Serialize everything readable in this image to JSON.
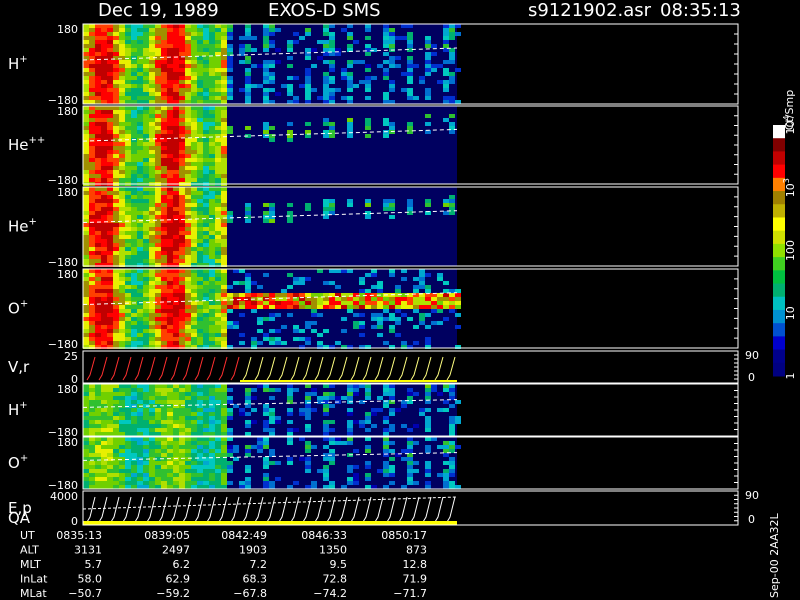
{
  "header": {
    "date": "Dec 19, 1989",
    "instrument": "EXOS-D SMS",
    "file": "s9121902.asr",
    "time": "08:35:13"
  },
  "panels": [
    {
      "label": "H",
      "sup": "+",
      "top": "180",
      "bottom": "−180",
      "kind": "spec"
    },
    {
      "label": "He",
      "sup": "++",
      "top": "180",
      "bottom": "−180",
      "kind": "spec"
    },
    {
      "label": "He",
      "sup": "+",
      "top": "180",
      "bottom": "−180",
      "kind": "spec"
    },
    {
      "label": "O",
      "sup": "+",
      "top": "180",
      "bottom": "−180",
      "kind": "spec"
    },
    {
      "label": "V,r",
      "sup": "",
      "top": "25",
      "bottom": "0",
      "right_top": "90",
      "right_bottom": "0",
      "kind": "line"
    },
    {
      "label": "H",
      "sup": "+",
      "top": "180",
      "bottom": "−180",
      "kind": "spec"
    },
    {
      "label": "O",
      "sup": "+",
      "top": "180",
      "bottom": "−180",
      "kind": "spec"
    },
    {
      "label": "E,p",
      "sup": "",
      "label2": "QA",
      "top": "4000",
      "bottom": "0",
      "right_top": "90",
      "right_bottom": "0",
      "kind": "line"
    }
  ],
  "colorbar": {
    "unit": "Ct/Smp",
    "ticks": [
      {
        "text": "10",
        "exp": "4",
        "frac": 1.0
      },
      {
        "text": "10",
        "exp": "3",
        "frac": 0.75
      },
      {
        "text": "100",
        "exp": "",
        "frac": 0.5
      },
      {
        "text": "10",
        "exp": "",
        "frac": 0.25
      },
      {
        "text": "1",
        "exp": "",
        "frac": 0.0
      }
    ],
    "colors": [
      "#000080",
      "#00008b",
      "#0000cd",
      "#0050d0",
      "#0090d0",
      "#00c0c0",
      "#00b070",
      "#00c040",
      "#40d020",
      "#90e000",
      "#d0e000",
      "#ffff00",
      "#c0b000",
      "#a08000",
      "#ff8000",
      "#ff0000",
      "#c00000",
      "#800000",
      "#ffffff"
    ]
  },
  "footer": {
    "rows": [
      {
        "name": "UT",
        "values": [
          "0835:13",
          "0839:05",
          "0842:49",
          "0846:33",
          "0850:17"
        ]
      },
      {
        "name": "ALT",
        "values": [
          "3131",
          "2497",
          "1903",
          "1350",
          "873"
        ]
      },
      {
        "name": "MLT",
        "values": [
          "5.7",
          "6.2",
          "7.2",
          "9.5",
          "12.8"
        ]
      },
      {
        "name": "InLat",
        "values": [
          "58.0",
          "62.9",
          "68.3",
          "72.8",
          "71.9"
        ]
      },
      {
        "name": "MLat",
        "values": [
          "−50.7",
          "−59.2",
          "−67.8",
          "−74.2",
          "−71.7"
        ]
      }
    ],
    "side_label": "Sep-00 2AA32L"
  },
  "chart_data": {
    "type": "heatmap",
    "title": "",
    "x": [
      "0835:13",
      "0839:05",
      "0842:49",
      "0846:33",
      "0850:17"
    ],
    "xlabel": "UT",
    "ylabel": "",
    "ylim": [
      -180,
      180
    ],
    "series": [
      {
        "name": "H+"
      },
      {
        "name": "He++"
      },
      {
        "name": "He+"
      },
      {
        "name": "O+"
      },
      {
        "name": "V,r"
      },
      {
        "name": "H+"
      },
      {
        "name": "O+"
      },
      {
        "name": "E,p"
      }
    ],
    "colorscale": "log",
    "zlim": [
      1,
      10000
    ],
    "zlabel": "Ct/Smp"
  }
}
